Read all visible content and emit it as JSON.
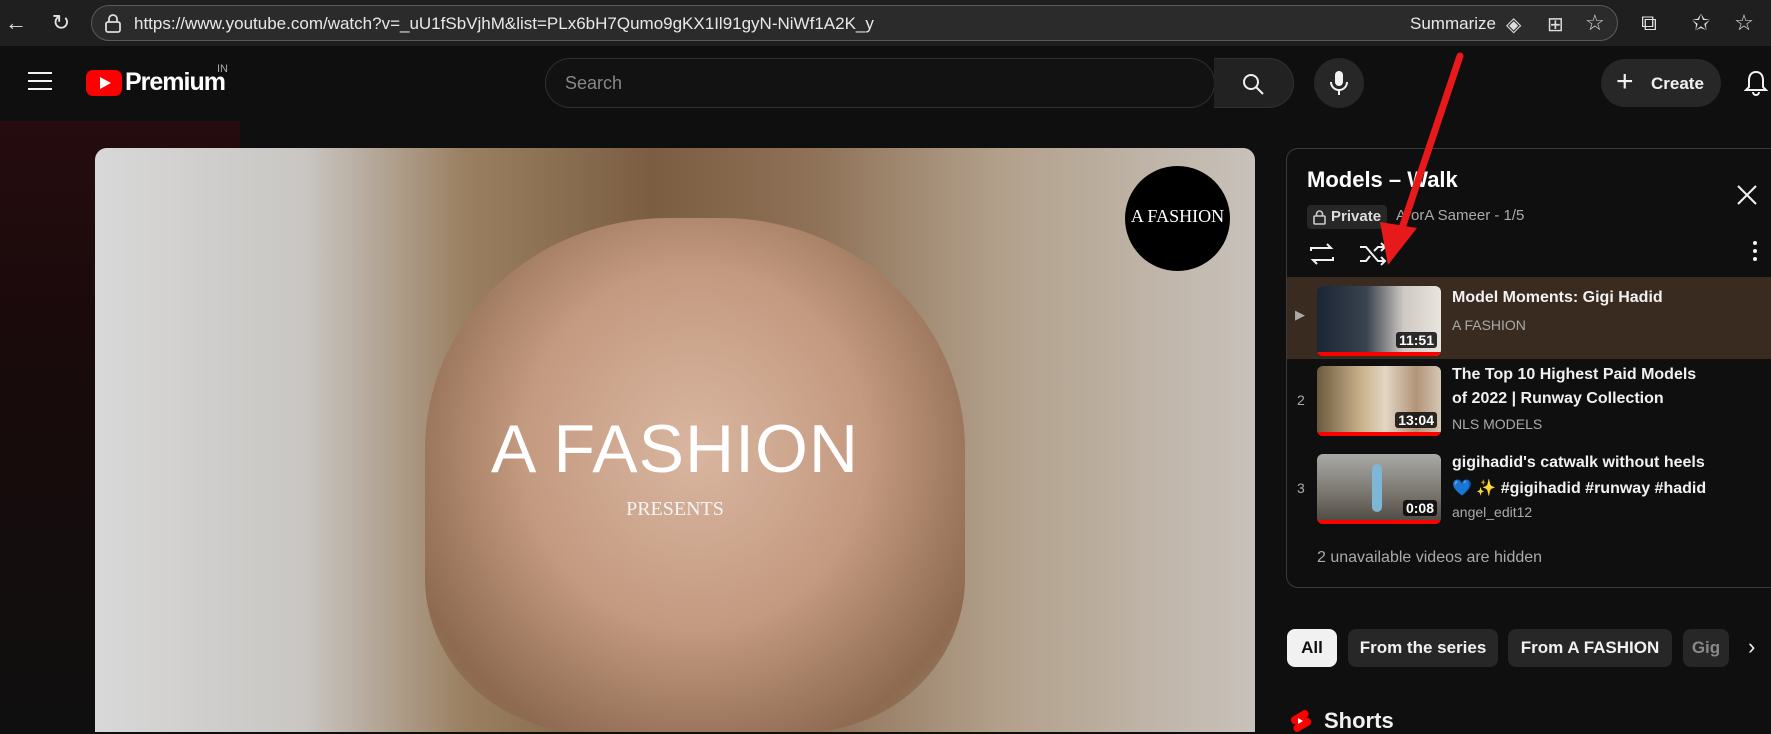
{
  "browser": {
    "url": "https://www.youtube.com/watch?v=_uU1fSbVjhM&list=PLx6bH7Qumo9gKX1Il91gyN-NiWf1A2K_y",
    "summarize_label": "Summarize"
  },
  "header": {
    "logo_text": "Premium",
    "country_code": "IN",
    "search_placeholder": "Search",
    "create_label": "Create"
  },
  "video": {
    "channel_badge": "A FASHION",
    "overlay_title": "A FASHION",
    "overlay_subtitle": "PRESENTS"
  },
  "playlist": {
    "title": "Models – Walk",
    "privacy": "Private",
    "meta": "ArorA Sameer - 1/5",
    "items": [
      {
        "index": "▶",
        "title_line1": "Model Moments: Gigi Hadid",
        "title_line2": "",
        "channel": "A FASHION",
        "duration": "11:51"
      },
      {
        "index": "2",
        "title_line1": "The Top 10 Highest Paid Models",
        "title_line2": "of 2022 | Runway Collection",
        "channel": "NLS MODELS",
        "duration": "13:04"
      },
      {
        "index": "3",
        "title_line1": "gigihadid's catwalk without heels",
        "title_line2": "💙 ✨ #gigihadid #runway #hadid",
        "channel": "angel_edit12",
        "duration": "0:08"
      }
    ],
    "hidden_note": "2 unavailable videos are hidden"
  },
  "chips": [
    "All",
    "From the series",
    "From A FASHION",
    "Gig"
  ],
  "shorts_label": "Shorts",
  "colors": {
    "accent_red": "#ff0000",
    "annotation_arrow": "#e8191b",
    "chip_selected": "#f1f1f1"
  }
}
